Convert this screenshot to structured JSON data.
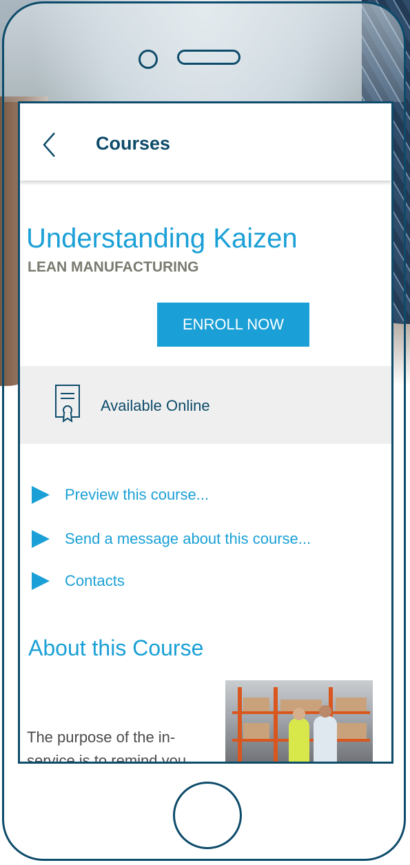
{
  "appbar": {
    "title": "Courses",
    "back_icon": "chevron-left-icon"
  },
  "course": {
    "title": "Understanding Kaizen",
    "category": "LEAN MANUFACTURING",
    "enroll_label": "ENROLL NOW",
    "availability_icon": "certificate-icon",
    "availability_text": "Available Online"
  },
  "links": [
    {
      "label": "Preview this course...",
      "icon": "play-triangle-icon"
    },
    {
      "label": "Send a message about this course...",
      "icon": "play-triangle-icon"
    },
    {
      "label": "Contacts",
      "icon": "play-triangle-icon"
    }
  ],
  "about": {
    "title": "About this Course",
    "text": "The purpose of the in-service is to remind you"
  },
  "colors": {
    "accent": "#1aa0d6",
    "brand_dark": "#0d4b6a",
    "band": "#efefef"
  }
}
